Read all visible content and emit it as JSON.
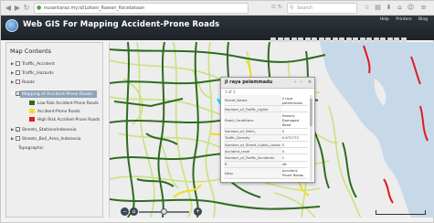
{
  "browser": {
    "url": "nusantaraz.my.id/Lokasi_Rawan_Kecelakaan",
    "search_placeholder": "Search"
  },
  "app": {
    "title": "Web GIS For Mapping Accident-Prone Roads",
    "links": [
      "Help",
      "Printers",
      "Blog"
    ]
  },
  "sidebar": {
    "title": "Map Contents",
    "layers": [
      {
        "label": "Traffic_Accident",
        "checked": false
      },
      {
        "label": "Traffic_Hazards",
        "checked": false
      },
      {
        "label": "Roads",
        "checked": false
      },
      {
        "label": "Mapping of Accident-Prone Roads",
        "checked": true,
        "selected": true
      }
    ],
    "legend": [
      {
        "label": "Low Risk Accident-Prone Roads",
        "color": "#2e6b1f"
      },
      {
        "label": "Accident-Prone Roads",
        "color": "#f1df1c"
      },
      {
        "label": "High Risk Accident-Prone Roads",
        "color": "#e21b1b"
      }
    ],
    "more_layers": [
      {
        "label": "Streets_StationsIndonesia",
        "checked": true
      },
      {
        "label": "Streets_Bali_Area_Indonesia",
        "checked": false
      }
    ],
    "footer": "Topographic"
  },
  "popup": {
    "title": "jl raya pelemmadu",
    "subtitle": "1 of 1",
    "rows": [
      {
        "key": "Street_Name",
        "value": "jl raya pelemmadu"
      },
      {
        "key": "Number_of_Traffic_Lights",
        "value": ""
      },
      {
        "key": "Road_Conditions",
        "value": "Heavily Damaged Road"
      },
      {
        "key": "Number_of_Ditch_",
        "value": "0"
      },
      {
        "key": "Traffic_Density",
        "value": "0.972773"
      },
      {
        "key": "Number_of_Street_Lights_Lanes",
        "value": "0"
      },
      {
        "key": "Accident_level",
        "value": "0"
      },
      {
        "key": "Number_of_Traffic_Accidents",
        "value": "1"
      },
      {
        "key": "R",
        "value": "46"
      },
      {
        "key": "Desc",
        "value": "Accident-Prone Roads"
      }
    ]
  },
  "map": {
    "colors": {
      "water": "#c7d9e8",
      "land": "#ededed",
      "low": "#2e6b1f",
      "medium": "#f1df1c",
      "high": "#e21b1b",
      "minor": "#c9e27e"
    }
  }
}
